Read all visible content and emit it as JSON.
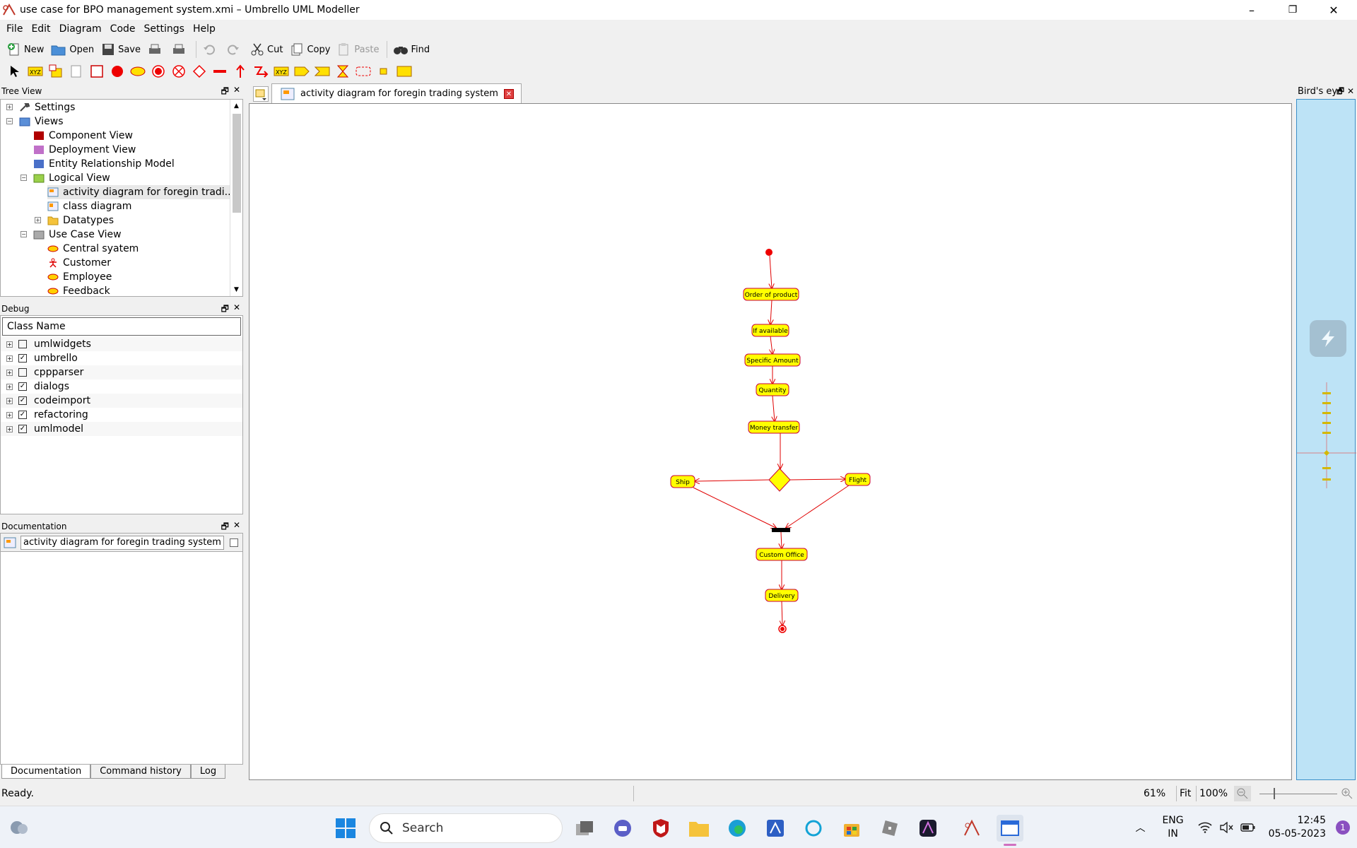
{
  "window": {
    "title": "use case for BPO management system.xmi – Umbrello UML Modeller",
    "minimize": "–",
    "maximize": "❐",
    "close": "✕"
  },
  "menu": [
    "File",
    "Edit",
    "Diagram",
    "Code",
    "Settings",
    "Help"
  ],
  "toolbar": {
    "new": "New",
    "open": "Open",
    "save": "Save",
    "cut": "Cut",
    "copy": "Copy",
    "paste": "Paste",
    "find": "Find"
  },
  "tree_view": {
    "title": "Tree View",
    "items": [
      {
        "label": "Settings",
        "icon": "wrench-icon",
        "level": 0,
        "expander": "+"
      },
      {
        "label": "Views",
        "icon": "folder-views-icon",
        "level": 0,
        "expander": "−"
      },
      {
        "label": "Component View",
        "icon": "component-view-icon",
        "level": 1
      },
      {
        "label": "Deployment View",
        "icon": "deployment-view-icon",
        "level": 1
      },
      {
        "label": "Entity Relationship Model",
        "icon": "er-model-icon",
        "level": 1
      },
      {
        "label": "Logical View",
        "icon": "logical-view-folder-icon",
        "level": 1,
        "expander": "−"
      },
      {
        "label": "activity diagram for foregin tradi...",
        "icon": "activity-diagram-icon",
        "level": 2,
        "selected": true
      },
      {
        "label": "class diagram",
        "icon": "class-diagram-icon",
        "level": 2
      },
      {
        "label": "Datatypes",
        "icon": "folder-icon",
        "level": 2,
        "expander": "+"
      },
      {
        "label": "Use Case View",
        "icon": "use-case-view-folder-icon",
        "level": 1,
        "expander": "−"
      },
      {
        "label": "Central syatem",
        "icon": "use-case-icon",
        "level": 2
      },
      {
        "label": "Customer",
        "icon": "actor-icon",
        "level": 2
      },
      {
        "label": "Employee",
        "icon": "use-case-icon",
        "level": 2
      },
      {
        "label": "Feedback",
        "icon": "use-case-icon",
        "level": 2
      }
    ]
  },
  "debug": {
    "title": "Debug",
    "column": "Class Name",
    "rows": [
      {
        "label": "umlwidgets",
        "checked": false
      },
      {
        "label": "umbrello",
        "checked": true
      },
      {
        "label": "cppparser",
        "checked": false
      },
      {
        "label": "dialogs",
        "checked": true
      },
      {
        "label": "codeimport",
        "checked": true
      },
      {
        "label": "refactoring",
        "checked": true
      },
      {
        "label": "umlmodel",
        "checked": true
      }
    ]
  },
  "documentation": {
    "title": "Documentation",
    "field": "activity diagram for foregin trading system",
    "tabs": [
      "Documentation",
      "Command history",
      "Log"
    ]
  },
  "diagram_tab": {
    "label": "activity diagram for foregin trading system"
  },
  "diagram": {
    "activities": [
      "Order of product",
      "If available",
      "Specific Amount",
      "Quantity",
      "Money transfer",
      "Ship",
      "Flight",
      "Custom Office",
      "Delivery"
    ]
  },
  "birds_eye": {
    "title": "Bird's eye"
  },
  "status": {
    "text": "Ready.",
    "zoom": "61%",
    "fit": "Fit",
    "full": "100%"
  },
  "taskbar": {
    "search": "Search",
    "lang1": "ENG",
    "lang2": "IN",
    "time": "12:45",
    "date": "05-05-2023",
    "notif": "1"
  },
  "colors": {
    "activity_fill": "#ffff00",
    "activity_border": "#c8003a",
    "arrow": "#e00000",
    "initial": "#ee0000"
  }
}
